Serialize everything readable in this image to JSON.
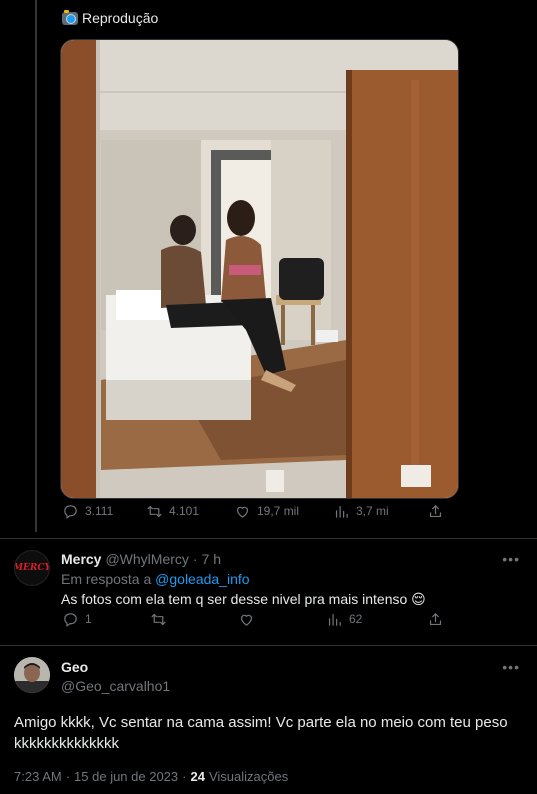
{
  "quoted": {
    "label": "Reprodução",
    "stats": {
      "replies": "3.111",
      "retweets": "4.101",
      "likes": "19,7 mil",
      "views": "3,7 mi"
    }
  },
  "reply": {
    "avatar_text": "MERCY",
    "name": "Mercy",
    "handle": "@WhylMercy",
    "separator": "·",
    "time": "7 h",
    "replying_to_prefix": "Em resposta a",
    "replying_to_handle": "@goleada_info",
    "text": "As fotos com ela tem q ser desse nivel pra mais intenso",
    "emoji": "😌",
    "stats": {
      "replies": "1",
      "retweets": "",
      "likes": "",
      "views": "62"
    }
  },
  "main_tweet": {
    "name": "Geo",
    "handle": "@Geo_carvalho1",
    "text": "Amigo kkkk, Vc sentar na cama assim! Vc parte ela no meio com teu peso kkkkkkkkkkkkkk",
    "time": "7:23 AM",
    "separator": "·",
    "date": "15 de jun de 2023",
    "views_count": "24",
    "views_label": "Visualizações"
  },
  "more_icon": "more-horizontal-icon",
  "colors": {
    "background": "#000000",
    "text": "#e7e9ea",
    "muted": "#71767b",
    "link": "#1d9bf0",
    "divider": "#2f3336"
  }
}
